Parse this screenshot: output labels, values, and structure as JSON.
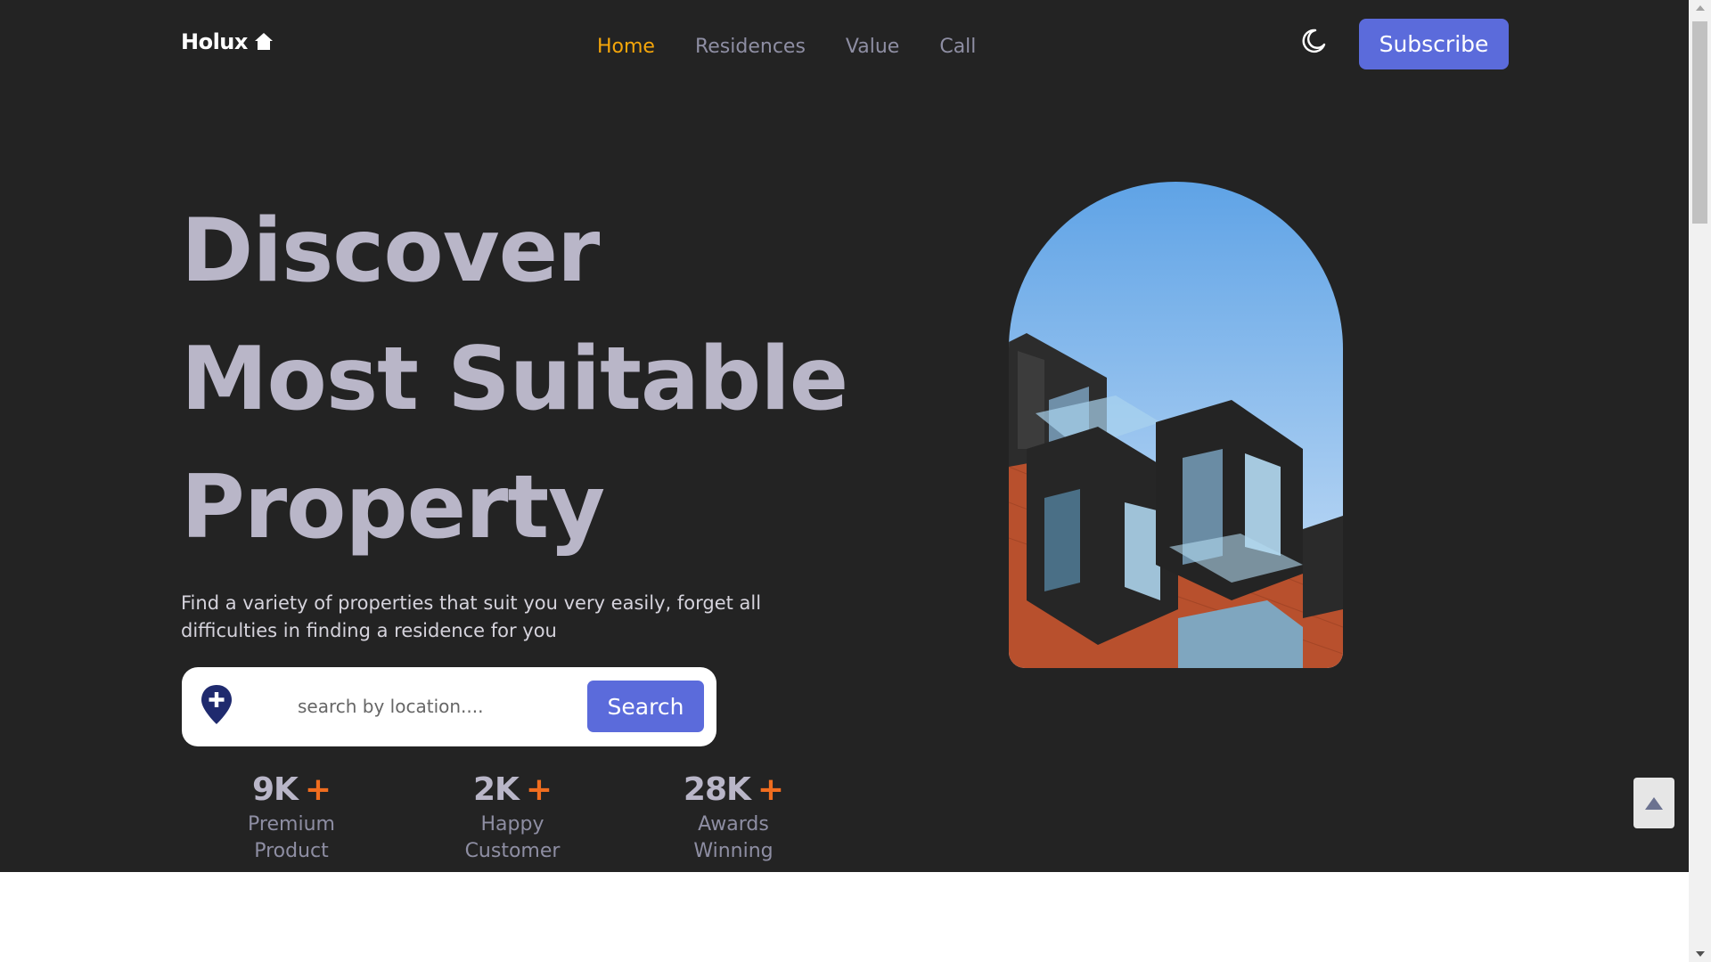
{
  "header": {
    "logo_text": "Holux",
    "logo_icon": "house-icon",
    "nav": [
      {
        "label": "Home",
        "active": true
      },
      {
        "label": "Residences",
        "active": false
      },
      {
        "label": "Value",
        "active": false
      },
      {
        "label": "Call",
        "active": false
      }
    ],
    "theme_toggle_icon": "moon-icon",
    "subscribe_label": "Subscribe"
  },
  "hero": {
    "title_lines": [
      "Discover",
      "Most Suitable",
      "Property"
    ],
    "description": "Find a variety of properties that suit you very easily, forget all difficulties in finding a residence for you",
    "search": {
      "icon": "location-pin-icon",
      "placeholder": "search by location....",
      "value": "",
      "button_label": "Search"
    },
    "stats": [
      {
        "number": "9K",
        "plus": "+",
        "label": "Premium Product"
      },
      {
        "number": "2K",
        "plus": "+",
        "label": "Happy Customer"
      },
      {
        "number": "28K",
        "plus": "+",
        "label": "Awards Winning"
      }
    ]
  },
  "colors": {
    "background": "#232323",
    "accent": "#5b6bdb",
    "active_nav": "#f5a60a",
    "plus": "#f06d1f",
    "heading": "#b9b6c8"
  },
  "scroll_top_icon": "arrow-up-icon"
}
